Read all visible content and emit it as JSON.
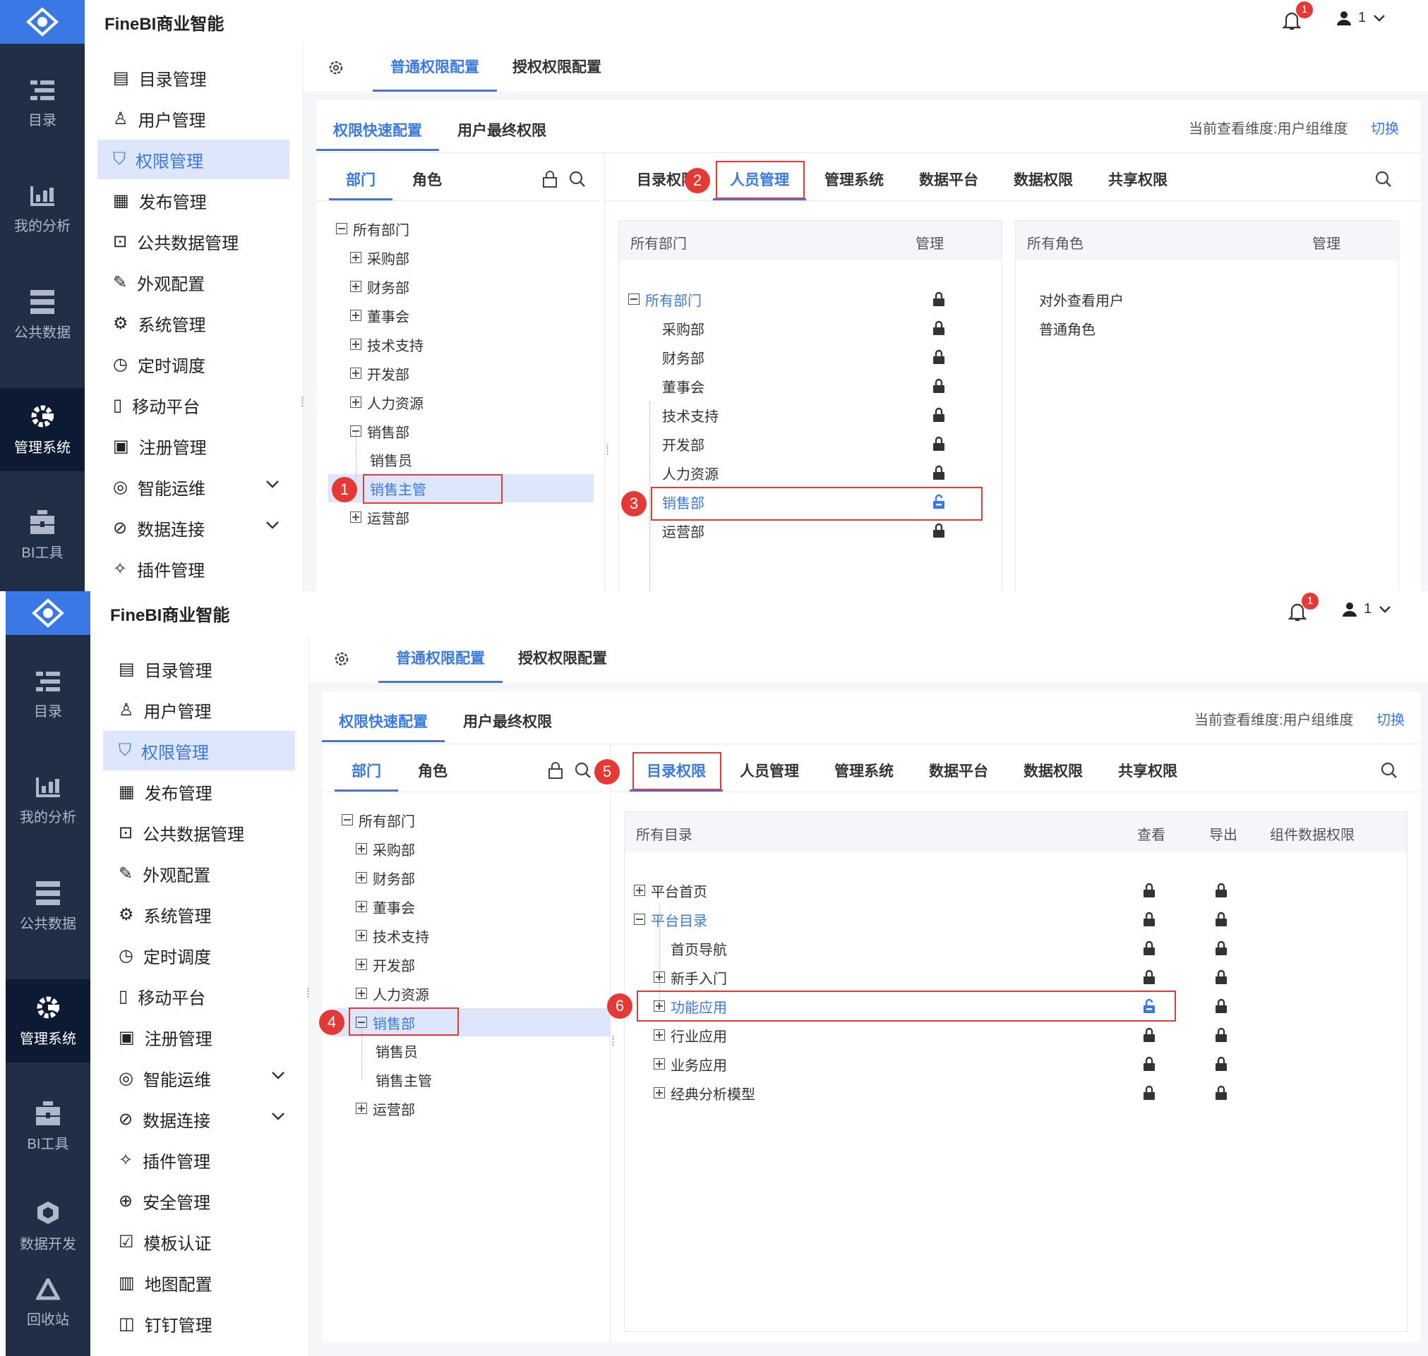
{
  "app": {
    "brand": "FineBI商业智能",
    "notification_count": "1",
    "user_name": "1"
  },
  "rail": [
    {
      "label": "目录",
      "icon": "catalog-icon"
    },
    {
      "label": "我的分析",
      "icon": "analysis-icon"
    },
    {
      "label": "公共数据",
      "icon": "public-data-icon"
    },
    {
      "label": "管理系统",
      "icon": "management-icon"
    },
    {
      "label": "BI工具",
      "icon": "bi-tools-icon"
    },
    {
      "label": "数据开发",
      "icon": "data-dev-icon"
    },
    {
      "label": "回收站",
      "icon": "recycle-bin-icon"
    }
  ],
  "menu": [
    {
      "label": "目录管理",
      "icon": "list-icon"
    },
    {
      "label": "用户管理",
      "icon": "user-icon"
    },
    {
      "label": "权限管理",
      "icon": "shield-icon"
    },
    {
      "label": "发布管理",
      "icon": "publish-icon"
    },
    {
      "label": "公共数据管理",
      "icon": "database-icon"
    },
    {
      "label": "外观配置",
      "icon": "brush-icon"
    },
    {
      "label": "系统管理",
      "icon": "gear-icon"
    },
    {
      "label": "定时调度",
      "icon": "timer-icon"
    },
    {
      "label": "移动平台",
      "icon": "mobile-icon"
    },
    {
      "label": "注册管理",
      "icon": "register-icon"
    },
    {
      "label": "智能运维",
      "icon": "ops-icon"
    },
    {
      "label": "数据连接",
      "icon": "link-icon"
    },
    {
      "label": "插件管理",
      "icon": "plugin-icon"
    },
    {
      "label": "安全管理",
      "icon": "security-icon"
    },
    {
      "label": "模板认证",
      "icon": "template-icon"
    },
    {
      "label": "地图配置",
      "icon": "map-icon"
    },
    {
      "label": "钉钉管理",
      "icon": "dingtalk-icon"
    }
  ],
  "top_tabs": [
    "普通权限配置",
    "授权权限配置"
  ],
  "sub_tabs": [
    "权限快速配置",
    "用户最终权限"
  ],
  "dimension_text": "当前查看维度:用户组维度",
  "switch_label": "切换",
  "left_tabs": [
    "部门",
    "角色"
  ],
  "perm_tabs": [
    "目录权限",
    "人员管理",
    "管理系统",
    "数据平台",
    "数据权限",
    "共享权限"
  ],
  "dept_tree": {
    "root": "所有部门",
    "children": [
      "采购部",
      "财务部",
      "董事会",
      "技术支持",
      "开发部",
      "人力资源",
      "销售部",
      "运营部"
    ],
    "sales_children": [
      "销售员",
      "销售主管"
    ]
  },
  "panel1": {
    "dept_grid": {
      "header": "所有部门",
      "col": "管理"
    },
    "role_grid": {
      "header": "所有角色",
      "col": "管理",
      "rows": [
        "对外查看用户",
        "普通角色"
      ]
    }
  },
  "panel2": {
    "dir_grid": {
      "header": "所有目录",
      "cols": [
        "查看",
        "导出",
        "组件数据权限"
      ],
      "rows": [
        {
          "label": "平台首页"
        },
        {
          "label": "平台目录"
        },
        {
          "label": "首页导航"
        },
        {
          "label": "新手入门"
        },
        {
          "label": "功能应用"
        },
        {
          "label": "行业应用"
        },
        {
          "label": "业务应用"
        },
        {
          "label": "经典分析模型"
        }
      ]
    }
  },
  "markers": [
    "1",
    "2",
    "3",
    "4",
    "5",
    "6"
  ],
  "colors": {
    "accent": "#3a78e6",
    "rail_bg": "#202e46",
    "highlight": "#e53935",
    "selected_bg": "#dde6fa"
  }
}
